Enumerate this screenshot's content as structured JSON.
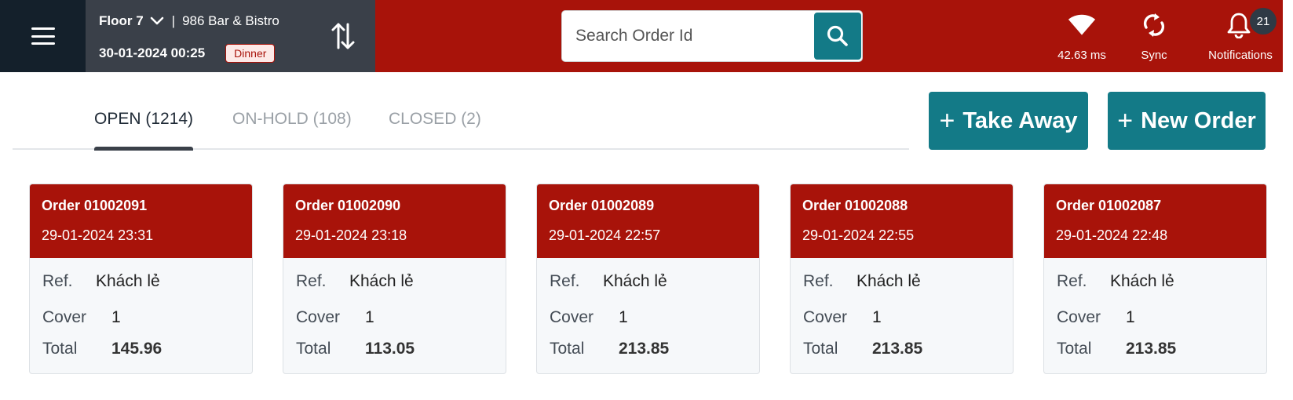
{
  "header": {
    "menu_icon": "hamburger-menu-icon",
    "location": {
      "floor": "Floor 7",
      "separator": "|",
      "venue": "986 Bar & Bistro",
      "datetime": "30-01-2024 00:25",
      "meal_period": "Dinner"
    },
    "swap_icon": "swap-vertical-icon",
    "search": {
      "placeholder": "Search Order Id",
      "value": "",
      "icon": "search-icon"
    },
    "status": {
      "latency_label": "42.63 ms",
      "latency_icon": "wifi-icon",
      "sync_label": "Sync",
      "sync_icon": "sync-icon",
      "notifications_label": "Notifications",
      "notifications_icon": "bell-icon",
      "notifications_count": "21"
    }
  },
  "tabs": [
    {
      "label": "OPEN (1214)",
      "active": true
    },
    {
      "label": "ON-HOLD (108)",
      "active": false
    },
    {
      "label": "CLOSED (2)",
      "active": false
    }
  ],
  "actions": {
    "plus_symbol": "+",
    "take_away_label": "Take Away",
    "new_order_label": "New Order"
  },
  "order_fields": {
    "ref_label": "Ref.",
    "cover_label": "Cover",
    "total_label": "Total"
  },
  "orders": [
    {
      "title": "Order 01002091",
      "date": "29-01-2024 23:31",
      "ref": "Khách lẻ",
      "cover": "1",
      "total": "145.96"
    },
    {
      "title": "Order 01002090",
      "date": "29-01-2024 23:18",
      "ref": "Khách lẻ",
      "cover": "1",
      "total": "113.05"
    },
    {
      "title": "Order 01002089",
      "date": "29-01-2024 22:57",
      "ref": "Khách lẻ",
      "cover": "1",
      "total": "213.85"
    },
    {
      "title": "Order 01002088",
      "date": "29-01-2024 22:55",
      "ref": "Khách lẻ",
      "cover": "1",
      "total": "213.85"
    },
    {
      "title": "Order 01002087",
      "date": "29-01-2024 22:48",
      "ref": "Khách lẻ",
      "cover": "1",
      "total": "213.85"
    }
  ],
  "colors": {
    "brand_red": "#a8130a",
    "accent_teal": "#137a87",
    "dark_navy": "#14202b",
    "slate": "#3a4049"
  }
}
